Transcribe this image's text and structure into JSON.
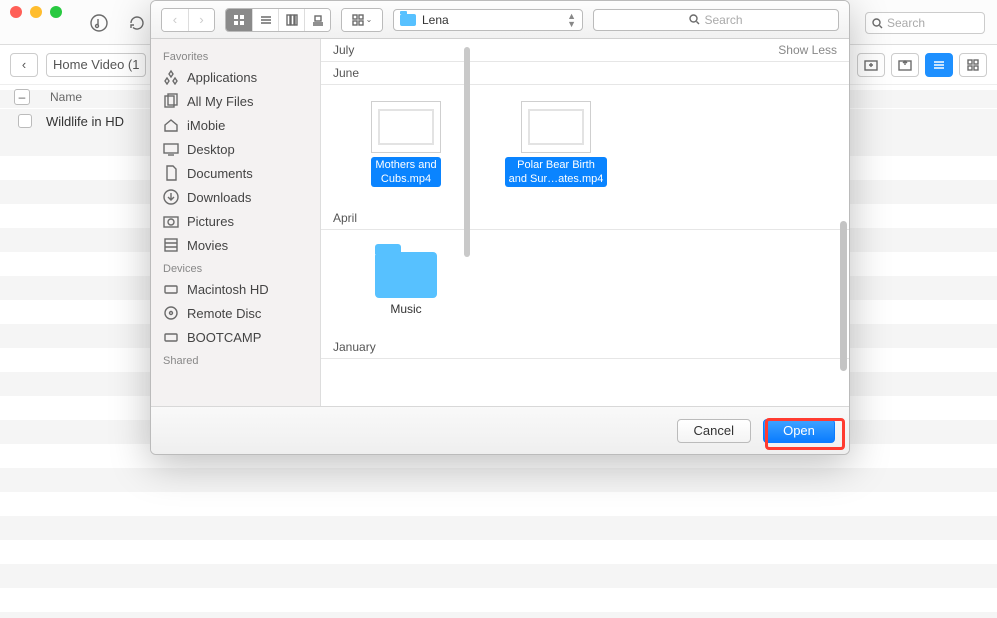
{
  "window": {
    "toolbar_search_placeholder": "Search",
    "back_label": "Home Video (1"
  },
  "list_header": {
    "name": "Name"
  },
  "items": [
    {
      "title": "Wildlife in HD"
    }
  ],
  "dialog": {
    "location_label": "Lena",
    "search_placeholder": "Search",
    "sidebar": {
      "favorites_header": "Favorites",
      "devices_header": "Devices",
      "shared_header": "Shared",
      "favorites": [
        {
          "icon": "apps",
          "label": "Applications"
        },
        {
          "icon": "files",
          "label": "All My Files"
        },
        {
          "icon": "home",
          "label": "iMobie"
        },
        {
          "icon": "desktop",
          "label": "Desktop"
        },
        {
          "icon": "doc",
          "label": "Documents"
        },
        {
          "icon": "download",
          "label": "Downloads"
        },
        {
          "icon": "camera",
          "label": "Pictures"
        },
        {
          "icon": "movie",
          "label": "Movies"
        }
      ],
      "devices": [
        {
          "icon": "hdd",
          "label": "Macintosh HD"
        },
        {
          "icon": "disc",
          "label": "Remote Disc"
        },
        {
          "icon": "hdd",
          "label": "BOOTCAMP"
        }
      ]
    },
    "sections": [
      {
        "header": "July",
        "show_less": "Show Less",
        "files": []
      },
      {
        "header": "June",
        "files": [
          {
            "name_line1": "Mothers and",
            "name_line2": "Cubs.mp4",
            "type": "video",
            "selected": true
          },
          {
            "name_line1": "Polar Bear Birth",
            "name_line2": "and Sur…ates.mp4",
            "type": "video",
            "selected": true
          }
        ]
      },
      {
        "header": "April",
        "files": [
          {
            "name_line1": "Music",
            "type": "folder",
            "selected": false
          }
        ]
      },
      {
        "header": "January",
        "files": []
      }
    ],
    "buttons": {
      "cancel": "Cancel",
      "open": "Open"
    }
  }
}
